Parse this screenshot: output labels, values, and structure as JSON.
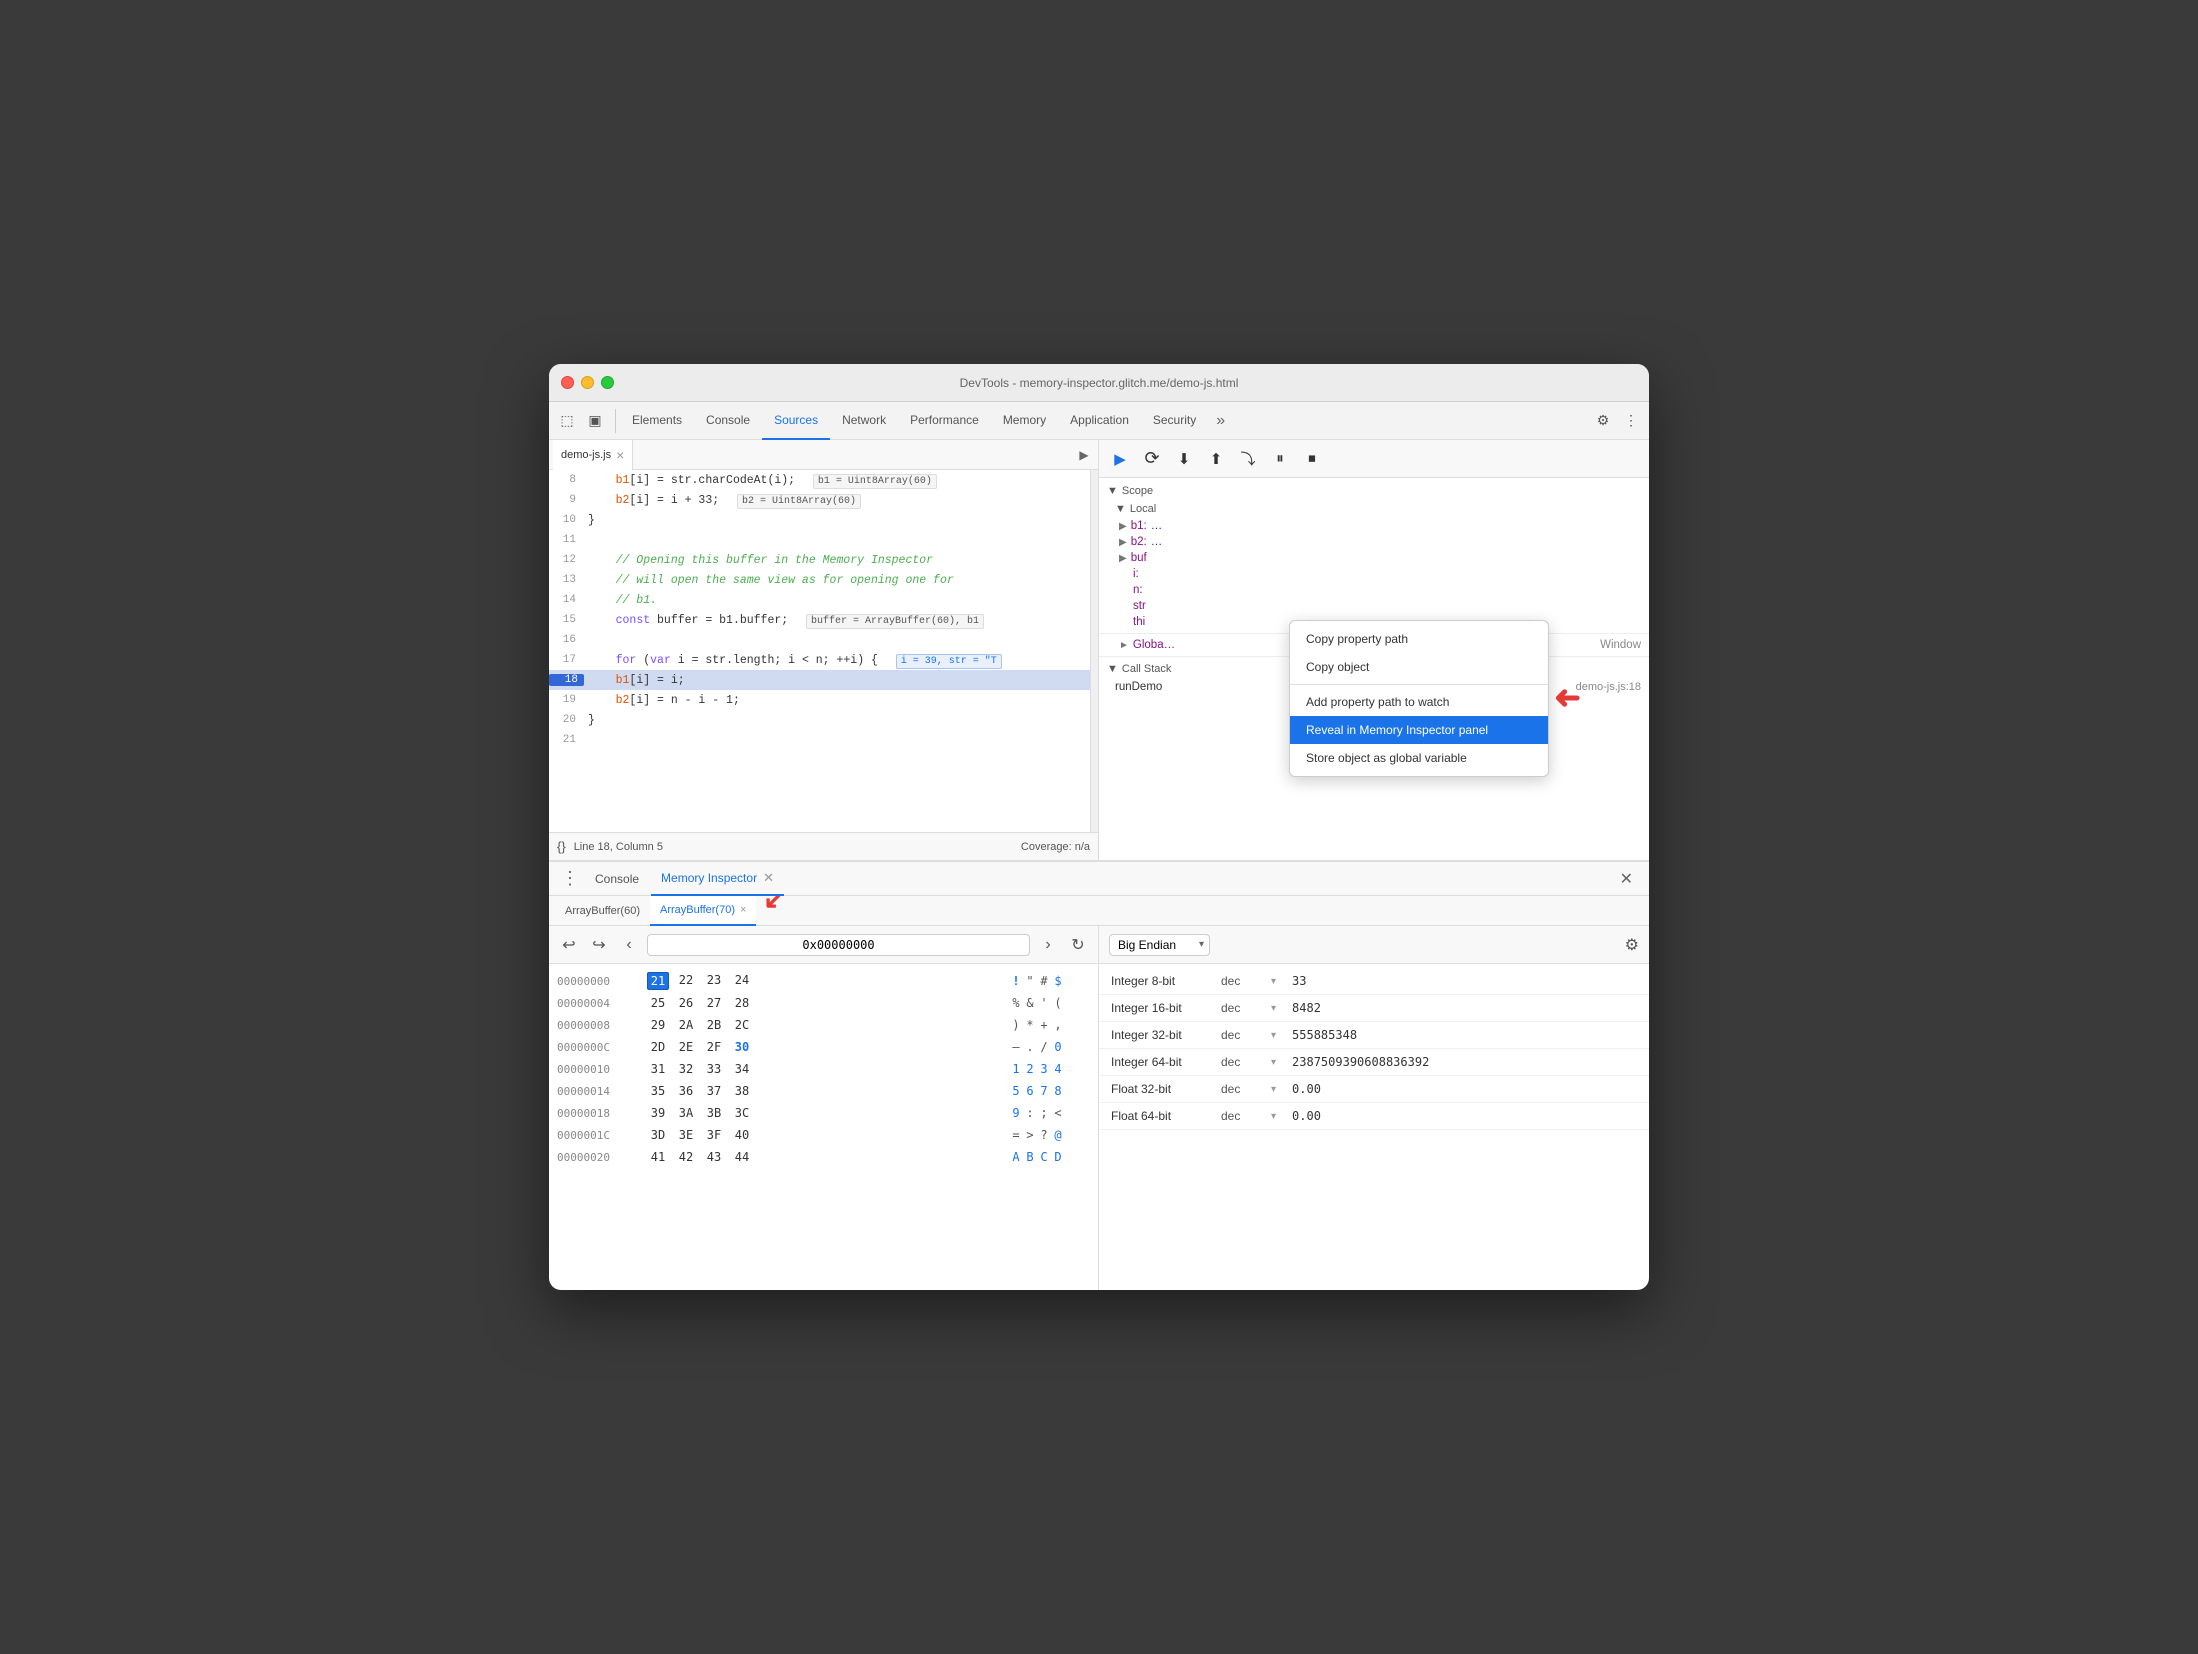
{
  "window": {
    "title": "DevTools - memory-inspector.glitch.me/demo-js.html",
    "traffic_lights": [
      "red",
      "yellow",
      "green"
    ]
  },
  "devtools_tabs": {
    "items": [
      {
        "label": "Elements",
        "active": false
      },
      {
        "label": "Console",
        "active": false
      },
      {
        "label": "Sources",
        "active": true
      },
      {
        "label": "Network",
        "active": false
      },
      {
        "label": "Performance",
        "active": false
      },
      {
        "label": "Memory",
        "active": false
      },
      {
        "label": "Application",
        "active": false
      },
      {
        "label": "Security",
        "active": false
      }
    ],
    "more_label": "»",
    "settings_icon": "⚙",
    "menu_icon": "⋮"
  },
  "sources": {
    "file_tab": "demo-js.js",
    "lines": [
      {
        "num": 8,
        "content": "    b1[i] = str.charCodeAt(i);"
      },
      {
        "num": 9,
        "content": "    b2[i] = i + 33;"
      },
      {
        "num": 10,
        "content": "}"
      },
      {
        "num": 11,
        "content": ""
      },
      {
        "num": 12,
        "content": "// Opening this buffer in the Memory Inspector"
      },
      {
        "num": 13,
        "content": "// will open the same view as for opening one for"
      },
      {
        "num": 14,
        "content": "// b1."
      },
      {
        "num": 15,
        "content": "const buffer = b1.buffer;"
      },
      {
        "num": 16,
        "content": ""
      },
      {
        "num": 17,
        "content": "for (var i = str.length; i < n; ++i) {"
      },
      {
        "num": 18,
        "content": "    b1[i] = i;",
        "active": true
      },
      {
        "num": 19,
        "content": "    b2[i] = n - i - 1;"
      },
      {
        "num": 20,
        "content": "}"
      },
      {
        "num": 21,
        "content": ""
      }
    ],
    "status_bar": {
      "icon": "{}",
      "position": "Line 18, Column 5",
      "coverage": "Coverage: n/a"
    }
  },
  "debugger": {
    "toolbar_buttons": [
      "▶",
      "⏸",
      "⏭",
      "⬆",
      "⬇",
      "⤵",
      "⏹"
    ],
    "scope_label": "▼ Scope",
    "local_label": "▼ Local",
    "scope_items": [
      {
        "key": "b1:",
        "val": "…"
      },
      {
        "key": "b2:",
        "val": "…"
      },
      {
        "key": "buf",
        "val": ""
      },
      {
        "key": "i:",
        "val": ""
      },
      {
        "key": "n:",
        "val": ""
      },
      {
        "key": "str",
        "val": ""
      }
    ],
    "global_label": "► Globa…",
    "window_label": "Window",
    "call_stack_label": "▼ Call Stack",
    "call_stack_items": [
      {
        "fn": "runDemo",
        "file": "demo-js.js:18"
      }
    ]
  },
  "context_menu": {
    "items": [
      {
        "label": "Copy property path",
        "selected": false
      },
      {
        "label": "Copy object",
        "selected": false
      },
      {
        "separator": true
      },
      {
        "label": "Add property path to watch",
        "selected": false
      },
      {
        "label": "Reveal in Memory Inspector panel",
        "selected": true
      },
      {
        "label": "Store object as global variable",
        "selected": false
      }
    ]
  },
  "bottom_panel": {
    "menu_icon": "⋮",
    "tabs": [
      {
        "label": "Console",
        "active": false,
        "closeable": false
      },
      {
        "label": "Memory Inspector",
        "active": true,
        "closeable": true
      }
    ],
    "close_btn": "✕",
    "buffer_tabs": [
      {
        "label": "ArrayBuffer(60)",
        "active": false,
        "closeable": false
      },
      {
        "label": "ArrayBuffer(70)",
        "active": true,
        "closeable": true
      }
    ]
  },
  "hex_panel": {
    "nav_back_disabled": true,
    "nav_forward_disabled": true,
    "address": "0x00000000",
    "rows": [
      {
        "addr": "00000000",
        "bytes": [
          "21",
          "22",
          "23",
          "24"
        ],
        "chars": [
          "!",
          "\"",
          "#",
          "$"
        ],
        "selected": 0
      },
      {
        "addr": "00000004",
        "bytes": [
          "25",
          "26",
          "27",
          "28"
        ],
        "chars": [
          "%",
          "&",
          "'",
          "("
        ]
      },
      {
        "addr": "00000008",
        "bytes": [
          "29",
          "2A",
          "2B",
          "2C"
        ],
        "chars": [
          ")",
          "*",
          "+",
          ","
        ]
      },
      {
        "addr": "0000000C",
        "bytes": [
          "2D",
          "2E",
          "2F",
          "30"
        ],
        "chars": [
          "-",
          ".",
          "/",
          "0"
        ]
      },
      {
        "addr": "00000010",
        "bytes": [
          "31",
          "32",
          "33",
          "34"
        ],
        "chars": [
          "1",
          "2",
          "3",
          "4"
        ]
      },
      {
        "addr": "00000014",
        "bytes": [
          "35",
          "36",
          "37",
          "38"
        ],
        "chars": [
          "5",
          "6",
          "7",
          "8"
        ]
      },
      {
        "addr": "00000018",
        "bytes": [
          "39",
          "3A",
          "3B",
          "3C"
        ],
        "chars": [
          "9",
          ":",
          ";",
          "<"
        ]
      },
      {
        "addr": "0000001C",
        "bytes": [
          "3D",
          "3E",
          "3F",
          "40"
        ],
        "chars": [
          "=",
          ">",
          "?",
          "@"
        ]
      },
      {
        "addr": "00000020",
        "bytes": [
          "41",
          "42",
          "43",
          "44"
        ],
        "chars": [
          "A",
          "B",
          "C",
          "D"
        ]
      }
    ]
  },
  "inspector_panel": {
    "endian": "Big Endian",
    "settings_icon": "⚙",
    "rows": [
      {
        "type": "Integer 8-bit",
        "format": "dec",
        "value": "33"
      },
      {
        "type": "Integer 16-bit",
        "format": "dec",
        "value": "8482"
      },
      {
        "type": "Integer 32-bit",
        "format": "dec",
        "value": "555885348"
      },
      {
        "type": "Integer 64-bit",
        "format": "dec",
        "value": "2387509390608836392"
      },
      {
        "type": "Float 32-bit",
        "format": "dec",
        "value": "0.00"
      },
      {
        "type": "Float 64-bit",
        "format": "dec",
        "value": "0.00"
      }
    ]
  },
  "arrows": {
    "context_menu_arrow": "↙",
    "buffer_tab_arrow": "↙"
  }
}
